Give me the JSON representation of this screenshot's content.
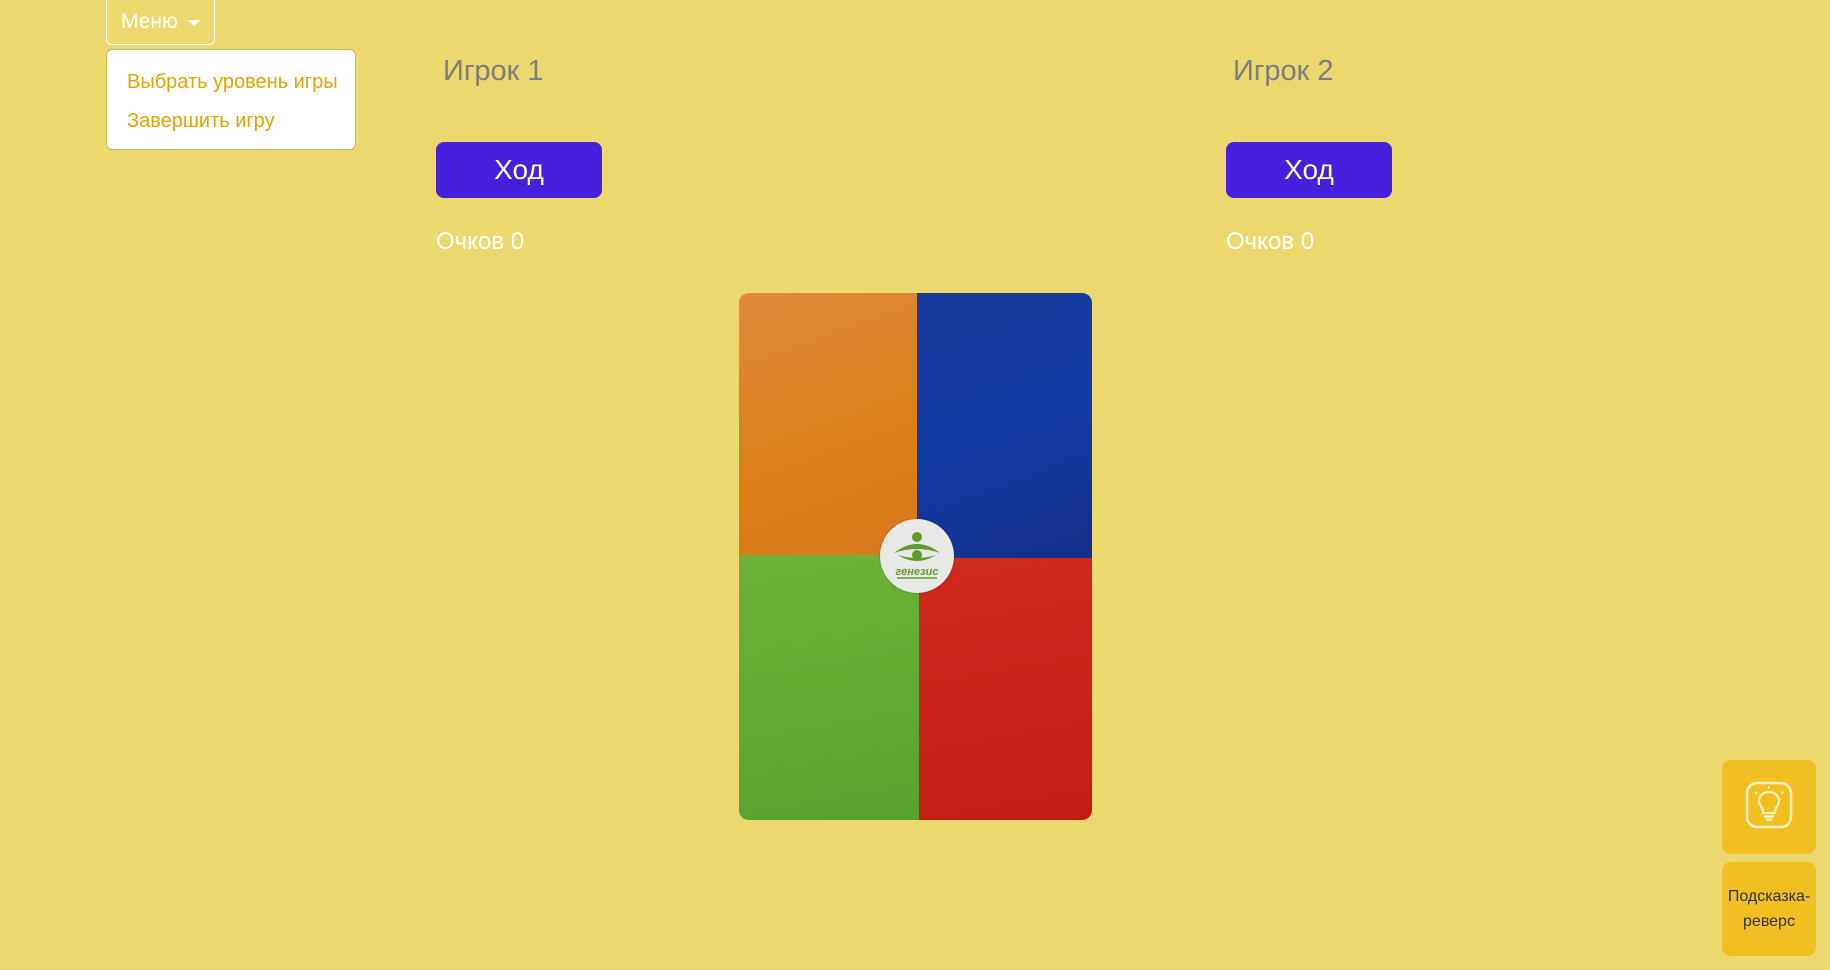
{
  "menu": {
    "label": "Меню",
    "items": [
      "Выбрать уровень игры",
      "Завершить игру"
    ]
  },
  "players": [
    {
      "name": "Игрок 1",
      "turn_label": "Ход",
      "score": "Очков 0"
    },
    {
      "name": "Игрок 2",
      "turn_label": "Ход",
      "score": "Очков 0"
    }
  ],
  "card": {
    "logo_text": "генезис",
    "quadrant_colors": [
      "#dc7f1a",
      "#123ca6",
      "#5faa31",
      "#c92117"
    ]
  },
  "hints": {
    "icon": "lightbulb-icon",
    "reverse_label_line1": "Подсказка-",
    "reverse_label_line2": "реверс"
  },
  "colors": {
    "background": "#ebd86e",
    "accent": "#4620dc",
    "hint": "#f2bf22",
    "menu_item": "#e3a300"
  }
}
